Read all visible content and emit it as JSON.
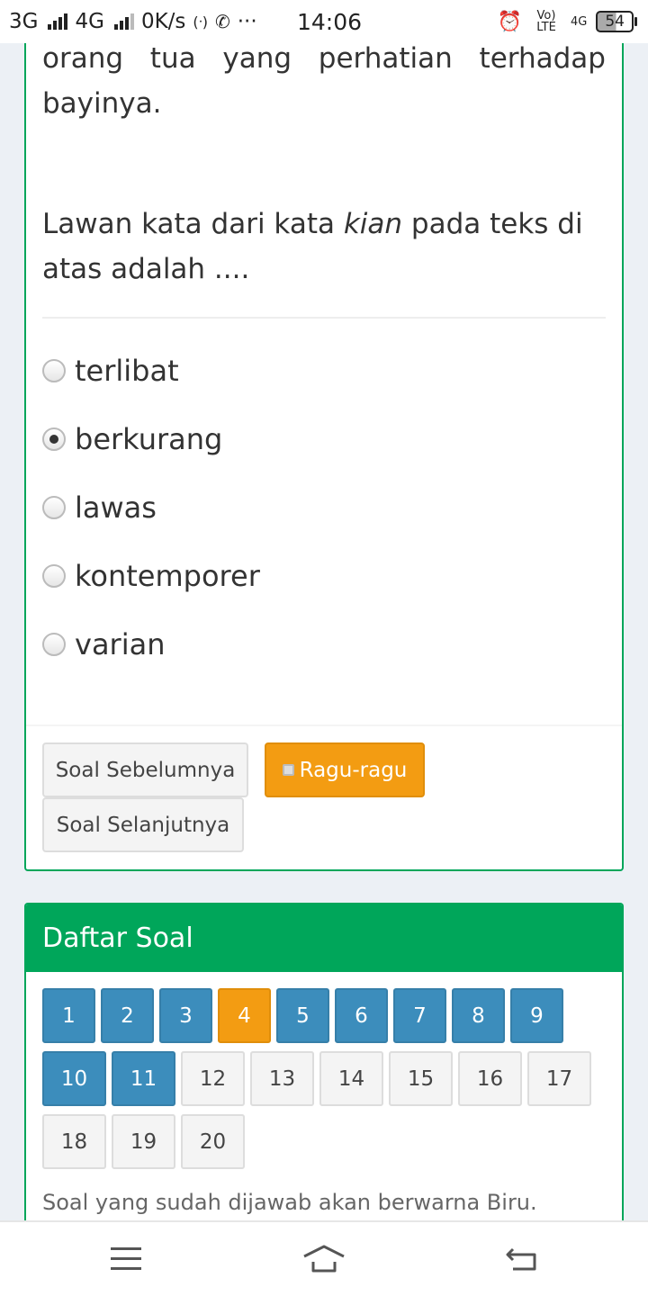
{
  "status_bar": {
    "net1": "3G",
    "net2": "4G",
    "speed": "0K/s",
    "dots": "···",
    "time": "14:06",
    "volte": "Vo) LTE",
    "net3": "4G",
    "battery": "54"
  },
  "question": {
    "line1_words": [
      "orang",
      "tua",
      "yang",
      "perhatian",
      "terhadap"
    ],
    "line2": "bayinya.",
    "prompt_before": "Lawan kata dari kata ",
    "prompt_italic": "kian",
    "prompt_after": " pada teks di atas adalah ....",
    "options": [
      {
        "label": "terlibat",
        "checked": false
      },
      {
        "label": "berkurang",
        "checked": true
      },
      {
        "label": "lawas",
        "checked": false
      },
      {
        "label": "kontemporer",
        "checked": false
      },
      {
        "label": "varian",
        "checked": false
      }
    ],
    "buttons": {
      "prev": "Soal Sebelumnya",
      "ragu": "Ragu-ragu",
      "next": "Soal Selanjutnya"
    }
  },
  "daftar": {
    "title": "Daftar Soal",
    "numbers_row1": [
      "1",
      "2",
      "3",
      "4",
      "5",
      "6",
      "7",
      "8",
      "9"
    ],
    "numbers_row2": [
      "10",
      "11",
      "12",
      "13",
      "14",
      "15",
      "16",
      "17"
    ],
    "numbers_row3": [
      "18",
      "19",
      "20"
    ],
    "hint": "Soal yang sudah dijawab akan berwarna Biru.",
    "colors": {
      "answered": "#3c8dbc",
      "doubt": "#f39c12",
      "unanswered": "#f4f4f4"
    }
  }
}
